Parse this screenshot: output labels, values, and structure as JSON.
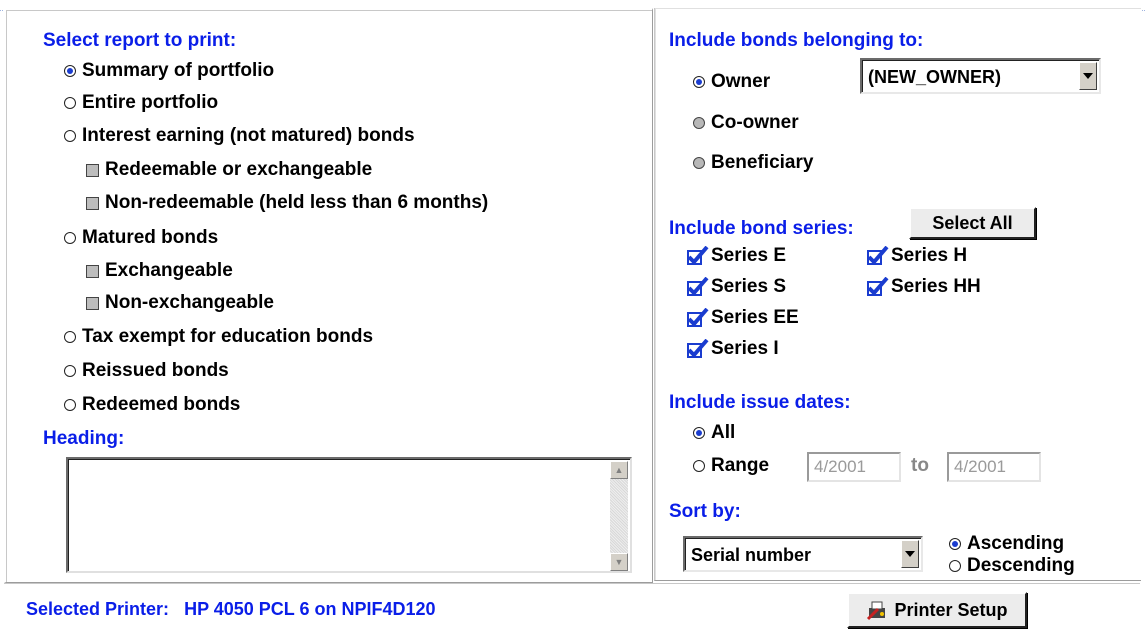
{
  "report": {
    "title": "Select report to print:",
    "options": [
      {
        "label": "Summary of portfolio",
        "type": "radio",
        "selected": true
      },
      {
        "label": "Entire portfolio",
        "type": "radio",
        "selected": false
      },
      {
        "label": "Interest earning (not matured) bonds",
        "type": "radio",
        "selected": false
      },
      {
        "label": "Redeemable or exchangeable",
        "type": "checkbox",
        "disabled": true
      },
      {
        "label": "Non-redeemable (held less than 6 months)",
        "type": "checkbox",
        "disabled": true
      },
      {
        "label": "Matured bonds",
        "type": "radio",
        "selected": false
      },
      {
        "label": "Exchangeable",
        "type": "checkbox",
        "disabled": true
      },
      {
        "label": "Non-exchangeable",
        "type": "checkbox",
        "disabled": true
      },
      {
        "label": "Tax exempt for education bonds",
        "type": "radio",
        "selected": false
      },
      {
        "label": "Reissued bonds",
        "type": "radio",
        "selected": false
      },
      {
        "label": "Redeemed bonds",
        "type": "radio",
        "selected": false
      }
    ]
  },
  "heading": {
    "label": "Heading:",
    "value": ""
  },
  "belonging": {
    "title": "Include bonds belonging to:",
    "owner": "Owner",
    "coowner": "Co-owner",
    "beneficiary": "Beneficiary",
    "owner_select_value": "(NEW_OWNER)"
  },
  "series": {
    "title": "Include bond series:",
    "select_all": "Select All",
    "items": [
      {
        "label": "Series E",
        "checked": true
      },
      {
        "label": "Series S",
        "checked": true
      },
      {
        "label": "Series EE",
        "checked": true
      },
      {
        "label": "Series I",
        "checked": true
      },
      {
        "label": "Series H",
        "checked": true
      },
      {
        "label": "Series HH",
        "checked": true
      }
    ]
  },
  "dates": {
    "title": "Include issue dates:",
    "all": "All",
    "range": "Range",
    "to": "to",
    "from_value": "4/2001",
    "to_value": "4/2001"
  },
  "sort": {
    "title": "Sort by:",
    "field_value": "Serial number",
    "ascending": "Ascending",
    "descending": "Descending"
  },
  "footer": {
    "printer_label": "Selected Printer:",
    "printer_name": "HP 4050 PCL 6 on NPIF4D120",
    "setup_button": "Printer Setup"
  },
  "colors": {
    "accent_text": "#0a1ee8",
    "check_blue": "#1a3ccf"
  }
}
